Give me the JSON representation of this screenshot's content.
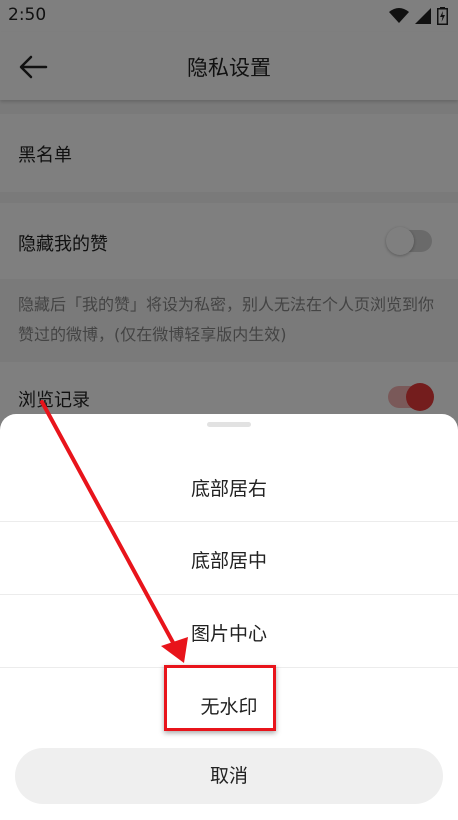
{
  "status_bar": {
    "time": "2:50",
    "icons": [
      "wifi-icon",
      "signal-icon",
      "battery-icon"
    ]
  },
  "header": {
    "title": "隐私设置",
    "back_icon": "back-arrow-icon"
  },
  "settings": {
    "blacklist_label": "黑名单",
    "hide_likes": {
      "label": "隐藏我的赞",
      "enabled": false
    },
    "hide_likes_description": "隐藏后「我的赞」将设为私密，别人无法在个人页浏览到你赞过的微博，(仅在微博轻享版内生效)",
    "browse_history": {
      "label": "浏览记录",
      "enabled": true
    }
  },
  "bottom_sheet": {
    "options": [
      "底部居右",
      "底部居中",
      "图片中心",
      "无水印"
    ],
    "cancel_label": "取消"
  },
  "annotation": {
    "highlighted_option": "无水印",
    "arrow_color": "#e8141b"
  },
  "colors": {
    "accent": "#e8141b",
    "toggle_on_knob": "#e83a3a",
    "toggle_off_knob": "#ffffff"
  }
}
